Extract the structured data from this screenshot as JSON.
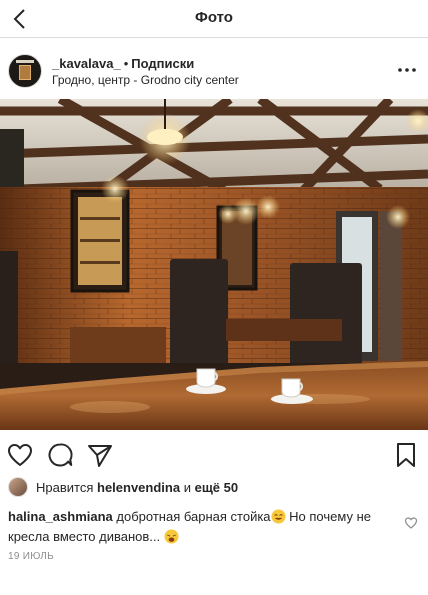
{
  "topbar": {
    "title": "Фото"
  },
  "post": {
    "username": "_kavalava_",
    "separator": "•",
    "follow_label": "Подписки",
    "location": "Гродно, центр - Grodno city center"
  },
  "likes": {
    "prefix": "Нравится",
    "liker": "helenvendina",
    "middle": "и",
    "others": "ещё 50"
  },
  "comment": {
    "author": "halina_ashmiana",
    "text_part1": "добротная барная стойка",
    "text_part2": "Но почему не кресла вместо диванов...",
    "emoji_1": "smiling-face-emoji",
    "emoji_2": "weary-face-emoji"
  },
  "date": "19 ИЮЛЬ"
}
